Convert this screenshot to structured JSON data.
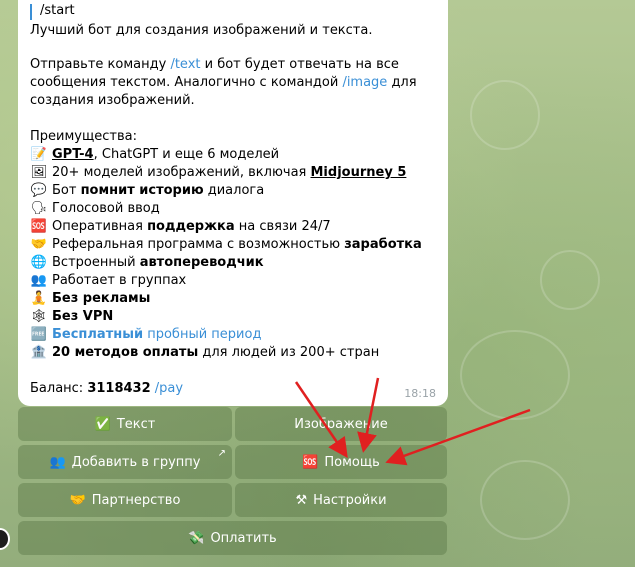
{
  "message": {
    "reply_command": "/start",
    "intro": "Лучший бот для создания изображений и текста.",
    "p1_a": "Отправьте команду ",
    "p1_cmd_text": "/text",
    "p1_b": " и бот будет отвечать на все",
    "p2_a": "сообщения текстом. Аналогично с командой ",
    "p2_cmd_image": "/image",
    "p2_b": " для",
    "p3": "создания изображений.",
    "advantages_title": "Преимущества:",
    "features": [
      {
        "icon": "memo-icon",
        "glyph": "📝",
        "bold_u": "GPT-4",
        "rest": ", ChatGPT и еще 6 моделей"
      },
      {
        "icon": "picture-icon",
        "glyph": "🖼",
        "pre": "20+ моделей изображений, включая ",
        "bold_u": "Midjourney 5"
      },
      {
        "icon": "speech-bubble-icon",
        "glyph": "💬",
        "pre": "Бот ",
        "bold": "помнит историю",
        "rest": " диалога"
      },
      {
        "icon": "speaking-head-icon",
        "glyph": "🗣",
        "pre": "Голосовой ввод"
      },
      {
        "icon": "sos-icon",
        "glyph": "🆘",
        "pre": "Оперативная ",
        "bold": "поддержка",
        "rest": " на связи 24/7"
      },
      {
        "icon": "handshake-icon",
        "glyph": "🤝",
        "pre": "Реферальная программа с возможностью ",
        "bold": "заработка"
      },
      {
        "icon": "globe-icon",
        "glyph": "🌐",
        "pre": "Встроенный ",
        "bold": "автопереводчик"
      },
      {
        "icon": "people-icon",
        "glyph": "👥",
        "pre": "Работает в группах"
      },
      {
        "icon": "meditation-icon",
        "glyph": "🧘",
        "bold": "Без рекламы"
      },
      {
        "icon": "web-icon",
        "glyph": "🕸",
        "bold": "Без VPN"
      },
      {
        "icon": "free-icon",
        "glyph": "🆓",
        "bold_link": "Бесплатный",
        "link": " пробный период"
      },
      {
        "icon": "bank-icon",
        "glyph": "🏦",
        "bold": "20 методов оплаты",
        "rest": " для людей из 200+ стран"
      }
    ],
    "balance_label": "Баланс: ",
    "balance_value": "3118432",
    "balance_cmd": " /pay",
    "time": "18:18"
  },
  "keyboard": {
    "text": {
      "icon": "✅",
      "label": "Текст"
    },
    "image": {
      "label": "Изображение"
    },
    "add_group": {
      "icon": "👥",
      "label": "Добавить в группу",
      "corner": "↗"
    },
    "help": {
      "icon": "🆘",
      "label": "Помощь"
    },
    "partner": {
      "icon": "🤝",
      "label": "Партнерство"
    },
    "settings": {
      "icon": "⚒",
      "label": "Настройки"
    },
    "pay": {
      "icon": "💸",
      "label": "Оплатить"
    }
  },
  "colors": {
    "link": "#3a8fd6",
    "arrow": "#e02020",
    "button_bg": "rgba(90,120,70,0.45)"
  }
}
